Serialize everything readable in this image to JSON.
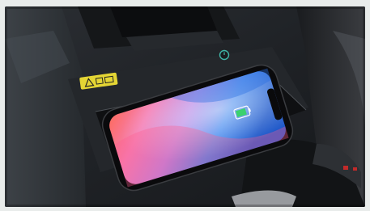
{
  "scene": {
    "subject": "smartphone-on-wireless-charging-pad",
    "colors": {
      "console_dark": "#1c1e21",
      "console_mid": "#2a2d31",
      "pad_black": "#0e0f11",
      "warning_yellow": "#e4d534",
      "phone_gradient_pink": "#f07aa8",
      "phone_gradient_blue": "#2a6cdc",
      "charging_green": "#3bd16f"
    },
    "icons": [
      "warning-sticker-icon",
      "power-button-icon",
      "battery-charging-icon"
    ]
  }
}
